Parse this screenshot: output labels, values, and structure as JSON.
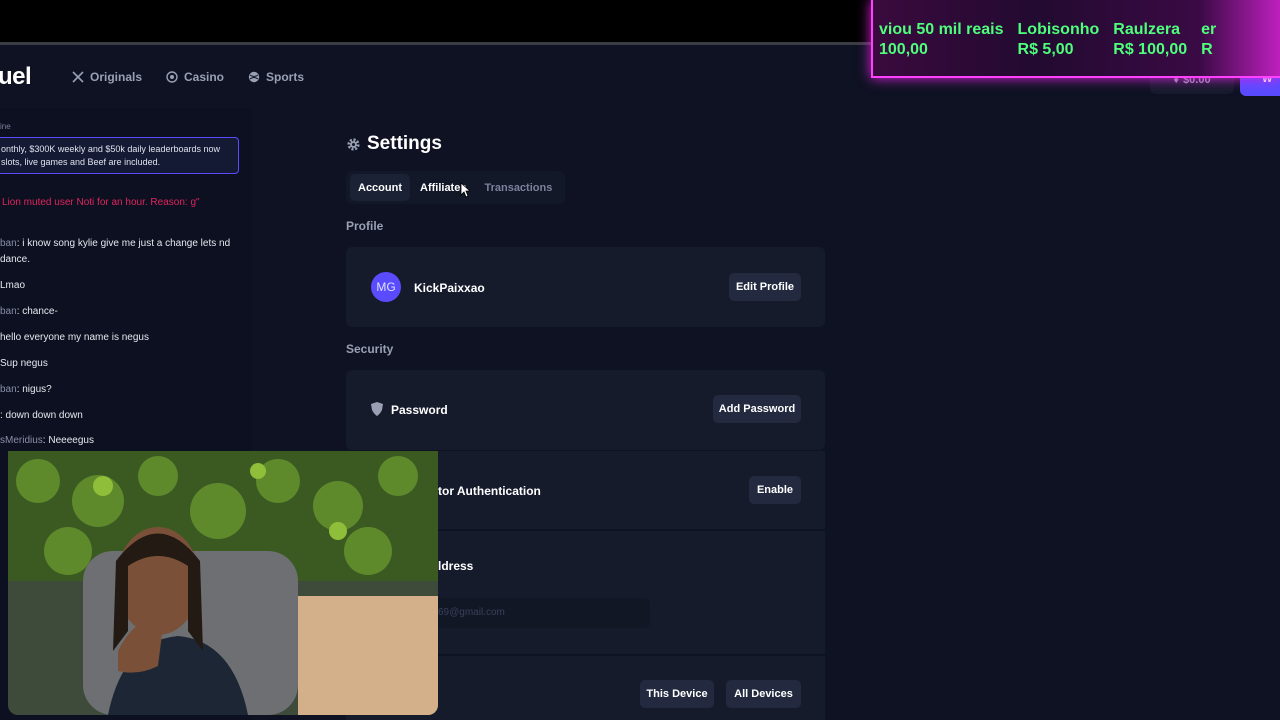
{
  "nav": {
    "logo": "uel",
    "items": [
      {
        "label": "Originals",
        "icon": "crossed-swords-icon"
      },
      {
        "label": "Casino",
        "icon": "chip-icon"
      },
      {
        "label": "Sports",
        "icon": "ball-icon"
      }
    ],
    "balance": "$0.00",
    "wallet_label": "W"
  },
  "chat": {
    "online_label": "ine",
    "pinned": "onthly, $300K weekly and $50k daily leaderboards now slots, live games and Beef are included.",
    "system": "Lion muted user Noti for an hour. Reason: g\"",
    "messages": [
      {
        "user": "ban",
        "text": ": i know song kylie give me just a change lets nd dance."
      },
      {
        "user": "",
        "text": "Lmao"
      },
      {
        "user": "ban",
        "text": ": chance-"
      },
      {
        "user": "",
        "text": "hello everyone my name is negus"
      },
      {
        "user": "",
        "text": "Sup negus"
      },
      {
        "user": "ban",
        "text": ": nigus?"
      },
      {
        "user": "",
        "text": ": down down down"
      },
      {
        "user": "sMeridius",
        "text": ": Neeeegus"
      }
    ]
  },
  "settings": {
    "title": "Settings",
    "tabs": [
      "Account",
      "Affiliates",
      "Transactions"
    ],
    "profile_label": "Profile",
    "avatar_initials": "MG",
    "username": "KickPaixxao",
    "edit_profile": "Edit Profile",
    "security_label": "Security",
    "password_label": "Password",
    "add_password": "Add Password",
    "twofa_label": "tor Authentication",
    "enable": "Enable",
    "email_label": "ldress",
    "email_value": "69@gmail.com",
    "this_device": "This Device",
    "all_devices": "All Devices"
  },
  "overlay": {
    "columns": [
      {
        "top": "viou 50 mil reais",
        "bottom": "100,00"
      },
      {
        "top": "Lobisonho",
        "bottom": "R$ 5,00"
      },
      {
        "top": "Raulzera",
        "bottom": "R$ 100,00"
      },
      {
        "top": "er",
        "bottom": "R"
      }
    ]
  },
  "colors": {
    "accent": "#5a4bff",
    "background": "#0e1222",
    "card": "#161b2c",
    "system_text": "#e0245e",
    "donation_text": "#4dff7a",
    "overlay_border": "#ff40ff"
  }
}
